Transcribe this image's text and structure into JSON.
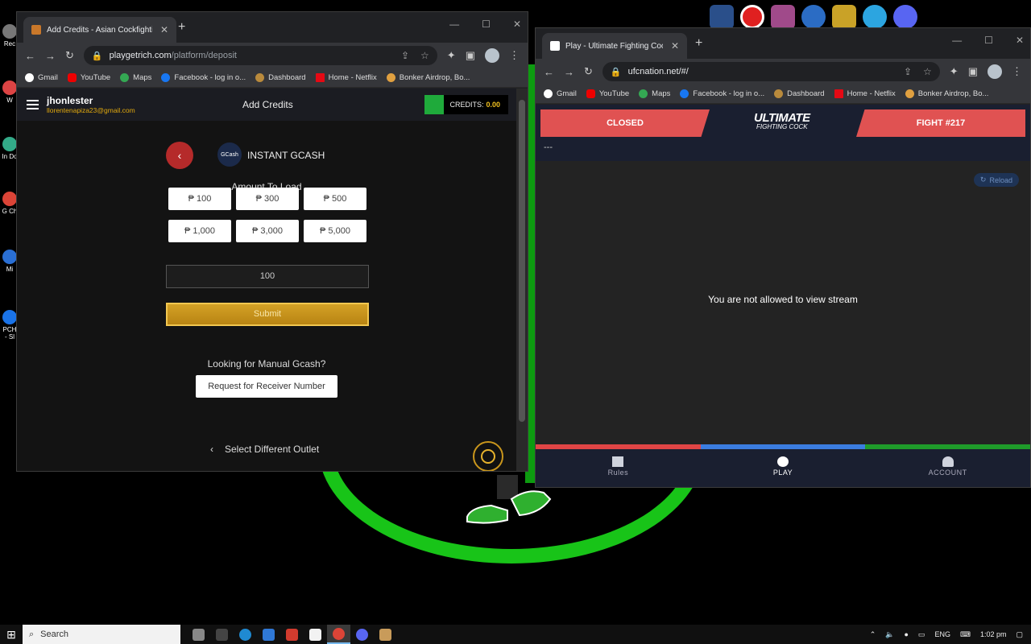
{
  "left_window": {
    "tab_title": "Add Credits - Asian Cockfighting",
    "url_domain": "playgetrich.com",
    "url_path": "/platform/deposit",
    "bookmarks": [
      "Gmail",
      "YouTube",
      "Maps",
      "Facebook - log in o...",
      "Dashboard",
      "Home - Netflix",
      "Bonker Airdrop, Bo..."
    ],
    "header": {
      "username": "jhonlester",
      "email": "llorentenapiza23@gmail.com",
      "title": "Add Credits",
      "credits_label": "CREDITS:",
      "credits_value": "0.00"
    },
    "payment": {
      "logo_text": "GCash",
      "method": "INSTANT GCASH",
      "back_icon": "chevron-left-icon"
    },
    "amount_title": "Amount To Load",
    "amounts": [
      "₱ 100",
      "₱ 300",
      "₱ 500",
      "₱ 1,000",
      "₱ 3,000",
      "₱ 5,000"
    ],
    "amount_value": "100",
    "submit_label": "Submit",
    "manual_question": "Looking for Manual Gcash?",
    "request_button": "Request for Receiver Number",
    "select_outlet": "Select Different Outlet"
  },
  "right_window": {
    "tab_title": "Play - Ultimate Fighting Cock",
    "url": "ufcnation.net/#/",
    "bookmarks": [
      "Gmail",
      "YouTube",
      "Maps",
      "Facebook - log in o...",
      "Dashboard",
      "Home - Netflix",
      "Bonker Airdrop, Bo..."
    ],
    "status": "CLOSED",
    "logo_line1": "ULTIMATE",
    "logo_line2": "FIGHTING COCK",
    "fight": "FIGHT #217",
    "dash": "---",
    "reload": "Reload",
    "stream_message": "You are not allowed to view stream",
    "nav": [
      "Rules",
      "PLAY",
      "ACCOUNT"
    ],
    "bar_colors": [
      "#e04545",
      "#3b7de0",
      "#1f9b2a"
    ]
  },
  "desktop": {
    "icon_labels": [
      "Rec",
      "W",
      "In Do",
      "G Ch",
      "Mi",
      "PCH - Sl"
    ]
  },
  "taskbar": {
    "search_placeholder": "Search",
    "lang": "ENG",
    "time": "1:02 pm"
  }
}
